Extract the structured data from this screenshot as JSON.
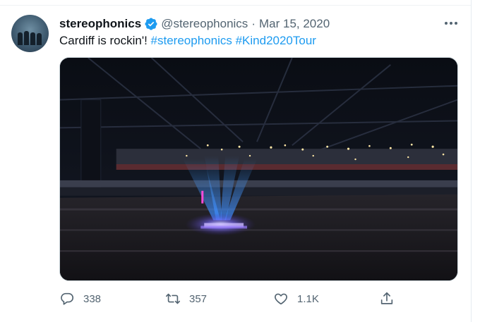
{
  "tweet": {
    "display_name": "stereophonics",
    "handle": "@stereophonics",
    "separator": "·",
    "date": "Mar 15, 2020",
    "text_plain": "Cardiff is rockin'!",
    "hashtags": [
      "#stereophonics",
      "#Kind2020Tour"
    ]
  },
  "actions": {
    "reply_count": "338",
    "retweet_count": "357",
    "like_count": "1.1K"
  },
  "icons": {
    "verified": "verified-badge-icon",
    "more": "more-options-icon",
    "reply": "reply-icon",
    "retweet": "retweet-icon",
    "like": "heart-icon",
    "share": "share-icon"
  },
  "colors": {
    "link": "#1d9bf0",
    "secondary_text": "#536471",
    "primary_text": "#0f1419"
  }
}
